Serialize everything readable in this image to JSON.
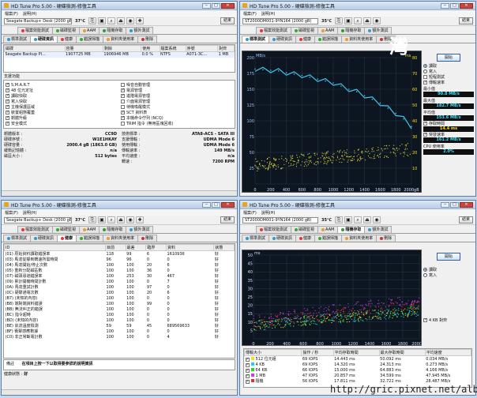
{
  "app": {
    "title": "HD Tune Pro 5.00 - 硬碟檢測-修復工具",
    "menu": [
      "檔案(F)",
      "說明(H)"
    ],
    "exit_label": "結束",
    "window_buttons": {
      "min": "‒",
      "max": "□",
      "close": "✕"
    }
  },
  "toolbar_icons": [
    "copy-icon",
    "save-icon",
    "zoom-icon",
    "eject-icon",
    "camera-icon",
    "settings-icon"
  ],
  "tabs_row1": [
    "檔案效能測試",
    "磁碟監視",
    "AAM",
    "隨機存取",
    "額外測試"
  ],
  "tabs_row2": [
    "標準測試",
    "硬碟資訊",
    "健康",
    "錯誤掃描",
    "資料夾使用率",
    "刪除"
  ],
  "win1": {
    "drive": "Seagate Backup+ Desk    (2000 gB)",
    "temp": "37℃",
    "active_tab": "硬碟資訊",
    "part_headers": [
      "磁碟",
      "容量",
      "剩餘",
      "使用",
      "檔案系統",
      "序號",
      "對齊"
    ],
    "part_row": [
      "Seagate Backup Pl...",
      "1907725 MB",
      "1906946 MB",
      "0.0 %",
      "NTFS",
      "A071-3C...",
      "1 MB"
    ],
    "features_label": "支援功能",
    "features": [
      {
        "name": "S.M.A.R.T",
        "on": true
      },
      {
        "name": "噪音自動管理",
        "on": false
      },
      {
        "name": "48 位元定址",
        "on": true
      },
      {
        "name": "電源管理",
        "on": true
      },
      {
        "name": "讀取快取",
        "on": true
      },
      {
        "name": "進階電源管理",
        "on": true
      },
      {
        "name": "寫入快取",
        "on": true
      },
      {
        "name": "介面電源管理",
        "on": false
      },
      {
        "name": "主機保護區域",
        "on": true
      },
      {
        "name": "待機喚醒模式",
        "on": false
      },
      {
        "name": "裝置組態覆蓋",
        "on": true
      },
      {
        "name": "SCT 資料表",
        "on": true
      },
      {
        "name": "韌體升級",
        "on": true
      },
      {
        "name": "本機命令佇列 (NCQ)",
        "on": true
      },
      {
        "name": "安全模式",
        "on": true
      },
      {
        "name": "TRIM 指令 (無用區塊回收)",
        "on": false
      }
    ],
    "info_left": [
      [
        "韌體版本 :",
        "CC9D"
      ],
      [
        "硬碟序號 :",
        "W1E1HKAY"
      ],
      [
        "硬碟容量 :",
        "2000.4 gB (1863.0 GB)"
      ],
      [
        "緩衝記憶體 :",
        "n/a"
      ],
      [
        "磁區大小 :",
        "512 bytes"
      ]
    ],
    "info_right": [
      [
        "技術標準 :",
        "ATA8-ACS - SATA III"
      ],
      [
        "支援傳輸 :",
        "UDMA Mode 6"
      ],
      [
        "使用傳輸 :",
        "UDMA Mode 6"
      ],
      [
        "傳輸速率 :",
        "149 MB/s"
      ],
      [
        "平均速度 :",
        "n/a"
      ],
      [
        "轉速 :",
        "7200 RPM"
      ]
    ]
  },
  "win2": {
    "drive": "ST2000DM001-9YN164       (2000 gB)",
    "temp": "35℃",
    "active_tab": "標準測試",
    "y_unit": "MB/s",
    "y_right_unit": "ms",
    "start": "開始",
    "read": "讀取",
    "write": "寫入",
    "short_stroke": "短程測試",
    "transfer_label": "傳輸速率",
    "min_label": "最小值",
    "min_val": "90.8 MB/s",
    "max_label": "最大值",
    "max_val": "182.7 MB/s",
    "avg_label": "平均值",
    "avg_val": "153.6 MB/s",
    "access_label": "存取時間",
    "access_val": "14.4 ms",
    "burst_label": "突發速率",
    "burst_val": "161.2 MB/s",
    "cpu_label": "CPU 使用率",
    "cpu_val": "2.0%"
  },
  "win3": {
    "drive": "Seagate Backup+ Desk    (2000 gB)",
    "temp": "37℃",
    "active_tab": "健康",
    "headers": [
      "ID",
      "目前",
      "最差",
      "臨界",
      "資料",
      "狀態"
    ],
    "rows": [
      [
        "(01) 原始資料讀取錯誤率",
        "118",
        "99",
        "6",
        "1610936",
        "好"
      ],
      [
        "(03) 馬達從靜到轉速所需時間",
        "96",
        "96",
        "0",
        "0",
        "好"
      ],
      [
        "(04) 馬達開始/停止次數",
        "100",
        "100",
        "20",
        "6",
        "好"
      ],
      [
        "(05) 重新分配磁區數",
        "100",
        "100",
        "36",
        "0",
        "好"
      ],
      [
        "(07) 磁頭尋道錯誤率",
        "100",
        "253",
        "30",
        "467",
        "好"
      ],
      [
        "(09) 累計開機時間計數",
        "100",
        "100",
        "0",
        "7",
        "好"
      ],
      [
        "(0A) 馬達重試計數",
        "100",
        "100",
        "97",
        "0",
        "好"
      ],
      [
        "(0C) 硬碟通電次數",
        "100",
        "100",
        "20",
        "6",
        "好"
      ],
      [
        "(B7) (未知的內容)",
        "100",
        "100",
        "0",
        "0",
        "好"
      ],
      [
        "(B8) 端對端資料錯誤",
        "100",
        "100",
        "99",
        "0",
        "好"
      ],
      [
        "(BB) 無法糾正的錯誤",
        "100",
        "100",
        "0",
        "0",
        "好"
      ],
      [
        "(BC) 指令超時",
        "100",
        "100",
        "0",
        "0",
        "好"
      ],
      [
        "(BD) (未知的內容)",
        "100",
        "100",
        "0",
        "0",
        "好"
      ],
      [
        "(BE) 氣流溫度檢測",
        "59",
        "59",
        "45",
        "689569633",
        "好"
      ],
      [
        "(BF) 衝擊感應數據",
        "100",
        "100",
        "0",
        "0",
        "好"
      ],
      [
        "(C0) 非正常斷電計數",
        "100",
        "100",
        "0",
        "4",
        "好"
      ]
    ],
    "foot_label": "備註",
    "foot_text": "在項目上按一下以取得要參詳的說明資訊",
    "status_label": "健康狀態 :",
    "status_value": "好"
  },
  "win4": {
    "drive": "ST2000DM001-9YN164       (2000 gB)",
    "temp": "35℃",
    "active_tab": "隨機存取",
    "y_unit": "ms",
    "start": "開始",
    "read": "讀取",
    "write": "寫入",
    "aligned": "4 KB 對齊",
    "table_headers": [
      "傳輸大小",
      "操作 / 秒",
      "平均存取時間",
      "最大存取時間",
      "平均速度"
    ],
    "table_rows": [
      {
        "color": "#f0e020",
        "size": "512 位元組",
        "ops": "69 IOPS",
        "avg": "14.443 ms",
        "max": "50.092 ms",
        "speed": "0.034 MB/s"
      },
      {
        "color": "#20d0f0",
        "size": "4 KB",
        "ops": "69 IOPS",
        "avg": "14.320 ms",
        "max": "24.313 ms",
        "speed": "0.273 MB/s"
      },
      {
        "color": "#30d030",
        "size": "64 KB",
        "ops": "66 IOPS",
        "avg": "15.000 ms",
        "max": "64.883 ms",
        "speed": "4.166 MB/s"
      },
      {
        "color": "#c040f0",
        "size": "1 MB",
        "ops": "47 IOPS",
        "avg": "20.857 ms",
        "max": "34.599 ms",
        "speed": "47.945 MB/s"
      },
      {
        "color": "#e03030",
        "size": "隨機",
        "ops": "56 IOPS",
        "avg": "17.811 ms",
        "max": "32.722 ms",
        "speed": "28.487 MB/s"
      }
    ]
  },
  "chart_data": [
    {
      "type": "line",
      "title": "",
      "xlabel": "",
      "ylabel": "MB/s",
      "xlim": [
        0,
        2000
      ],
      "x_ticks": [
        "0",
        "200",
        "400",
        "600",
        "800",
        "1000",
        "1200",
        "1400",
        "1600",
        "1800",
        "2000gB"
      ],
      "ylim": [
        0,
        200
      ],
      "y_ticks": [
        "200",
        "175",
        "150",
        "125",
        "100",
        "75",
        "50",
        "25"
      ],
      "y2lim": [
        0,
        80
      ],
      "y2_ticks": [
        "80",
        "70",
        "60",
        "50",
        "40",
        "30",
        "20",
        "10"
      ],
      "series": [
        {
          "values_x": [
            0,
            100,
            200,
            300,
            400,
            500,
            600,
            700,
            800,
            900,
            1000,
            1100,
            1200,
            1300,
            1400,
            1500,
            1600,
            1700,
            1800,
            1900,
            2000
          ],
          "values": [
            182,
            181,
            180,
            179,
            176,
            174,
            172,
            169,
            166,
            163,
            160,
            155,
            150,
            146,
            140,
            134,
            128,
            120,
            112,
            103,
            91
          ]
        }
      ],
      "scatter_note_access_ms_range": [
        8,
        25
      ]
    },
    {
      "type": "scatter",
      "title": "",
      "xlabel": "",
      "ylabel": "ms",
      "xlim": [
        0,
        2000
      ],
      "x_ticks": [
        "0",
        "200",
        "400",
        "600",
        "800",
        "1000",
        "1200",
        "1400",
        "1600",
        "1800",
        "2000gB"
      ],
      "ylim": [
        0,
        50
      ],
      "y_ticks": [
        "50",
        "45",
        "40",
        "35",
        "30",
        "25",
        "20",
        "15",
        "10",
        "5"
      ]
    }
  ],
  "watermark": "http://gric.pixnet.net/album",
  "badge": "灣"
}
